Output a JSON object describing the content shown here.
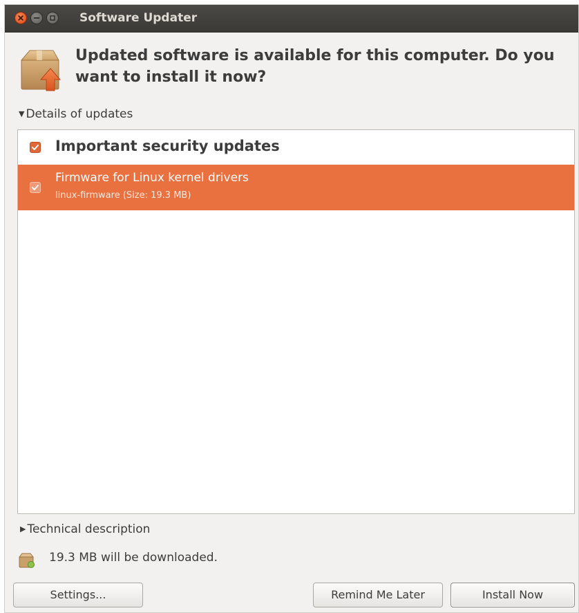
{
  "window": {
    "title": "Software Updater"
  },
  "header": {
    "headline": "Updated software is available for this computer. Do you want to install it now?"
  },
  "details_expander": {
    "arrow": "▼",
    "label": "Details of updates",
    "expanded": true
  },
  "updates": {
    "group": {
      "label": "Important security updates",
      "checked": true
    },
    "items": [
      {
        "title": "Firmware for Linux kernel drivers",
        "subtitle": "linux-firmware (Size: 19.3 MB)",
        "checked": true,
        "selected": true
      }
    ]
  },
  "tech_expander": {
    "arrow": "▶",
    "label": "Technical description",
    "expanded": false
  },
  "download": {
    "icon": "download-package-icon",
    "text": "19.3 MB will be downloaded."
  },
  "buttons": {
    "settings": "Settings...",
    "remind": "Remind Me Later",
    "install": "Install Now"
  },
  "icons": {
    "close": "close-icon",
    "minimize": "minimize-icon",
    "maximize": "maximize-icon",
    "header": "package-update-icon",
    "checkbox": "checkmark-icon"
  },
  "colors": {
    "accent": "#e9703f",
    "titlebar": "#3c3b37",
    "close_button": "#e2531d"
  }
}
